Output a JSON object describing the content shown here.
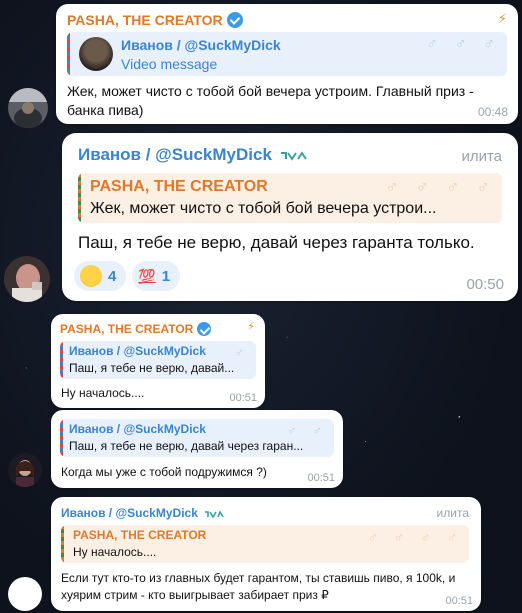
{
  "messages": [
    {
      "sender": "PASHA, THE CREATOR",
      "reply": {
        "sender": "Иванов / @SuckMyDick",
        "text": "Video message"
      },
      "text": "Жек, может чисто с тобой бой вечера устроим. Главный приз - банка пива)",
      "time": "00:48"
    },
    {
      "sender": "Иванов / @SuckMyDick",
      "tag": "илита",
      "reply": {
        "sender": "PASHA, THE CREATOR",
        "text": "Жек, может чисто с тобой бой вечера устрои..."
      },
      "text": "Паш, я тебе не верю, давай через гаранта только.",
      "reactions": [
        {
          "emoji": "grin-emoji",
          "count": "4"
        },
        {
          "emoji": "100-emoji",
          "count": "1"
        }
      ],
      "time": "00:50"
    },
    {
      "sender": "PASHA, THE CREATOR",
      "reply": {
        "sender": "Иванов / @SuckMyDick",
        "text": "Паш, я тебе не верю, давай..."
      },
      "text": "Ну началось....",
      "time": "00:51"
    },
    {
      "reply": {
        "sender": "Иванов / @SuckMyDick",
        "text": "Паш, я тебе не верю, давай через гаран..."
      },
      "text": "Когда мы уже с тобой подружимся ?)",
      "time": "00:51"
    },
    {
      "sender": "Иванов / @SuckMyDick",
      "tag": "илита",
      "reply": {
        "sender": "PASHA, THE CREATOR",
        "text": "Ну началось...."
      },
      "text": "Если тут кто-то из главных будет гарантом, ты ставишь пиво, я 100k, и хуярим стрим - кто выигрывает забирает приз ₽",
      "time": "00:51"
    }
  ],
  "colors": {
    "orange": "#e0792a",
    "blue": "#3a84d0",
    "bubble": "#ffffff",
    "background": "#0f1520"
  }
}
